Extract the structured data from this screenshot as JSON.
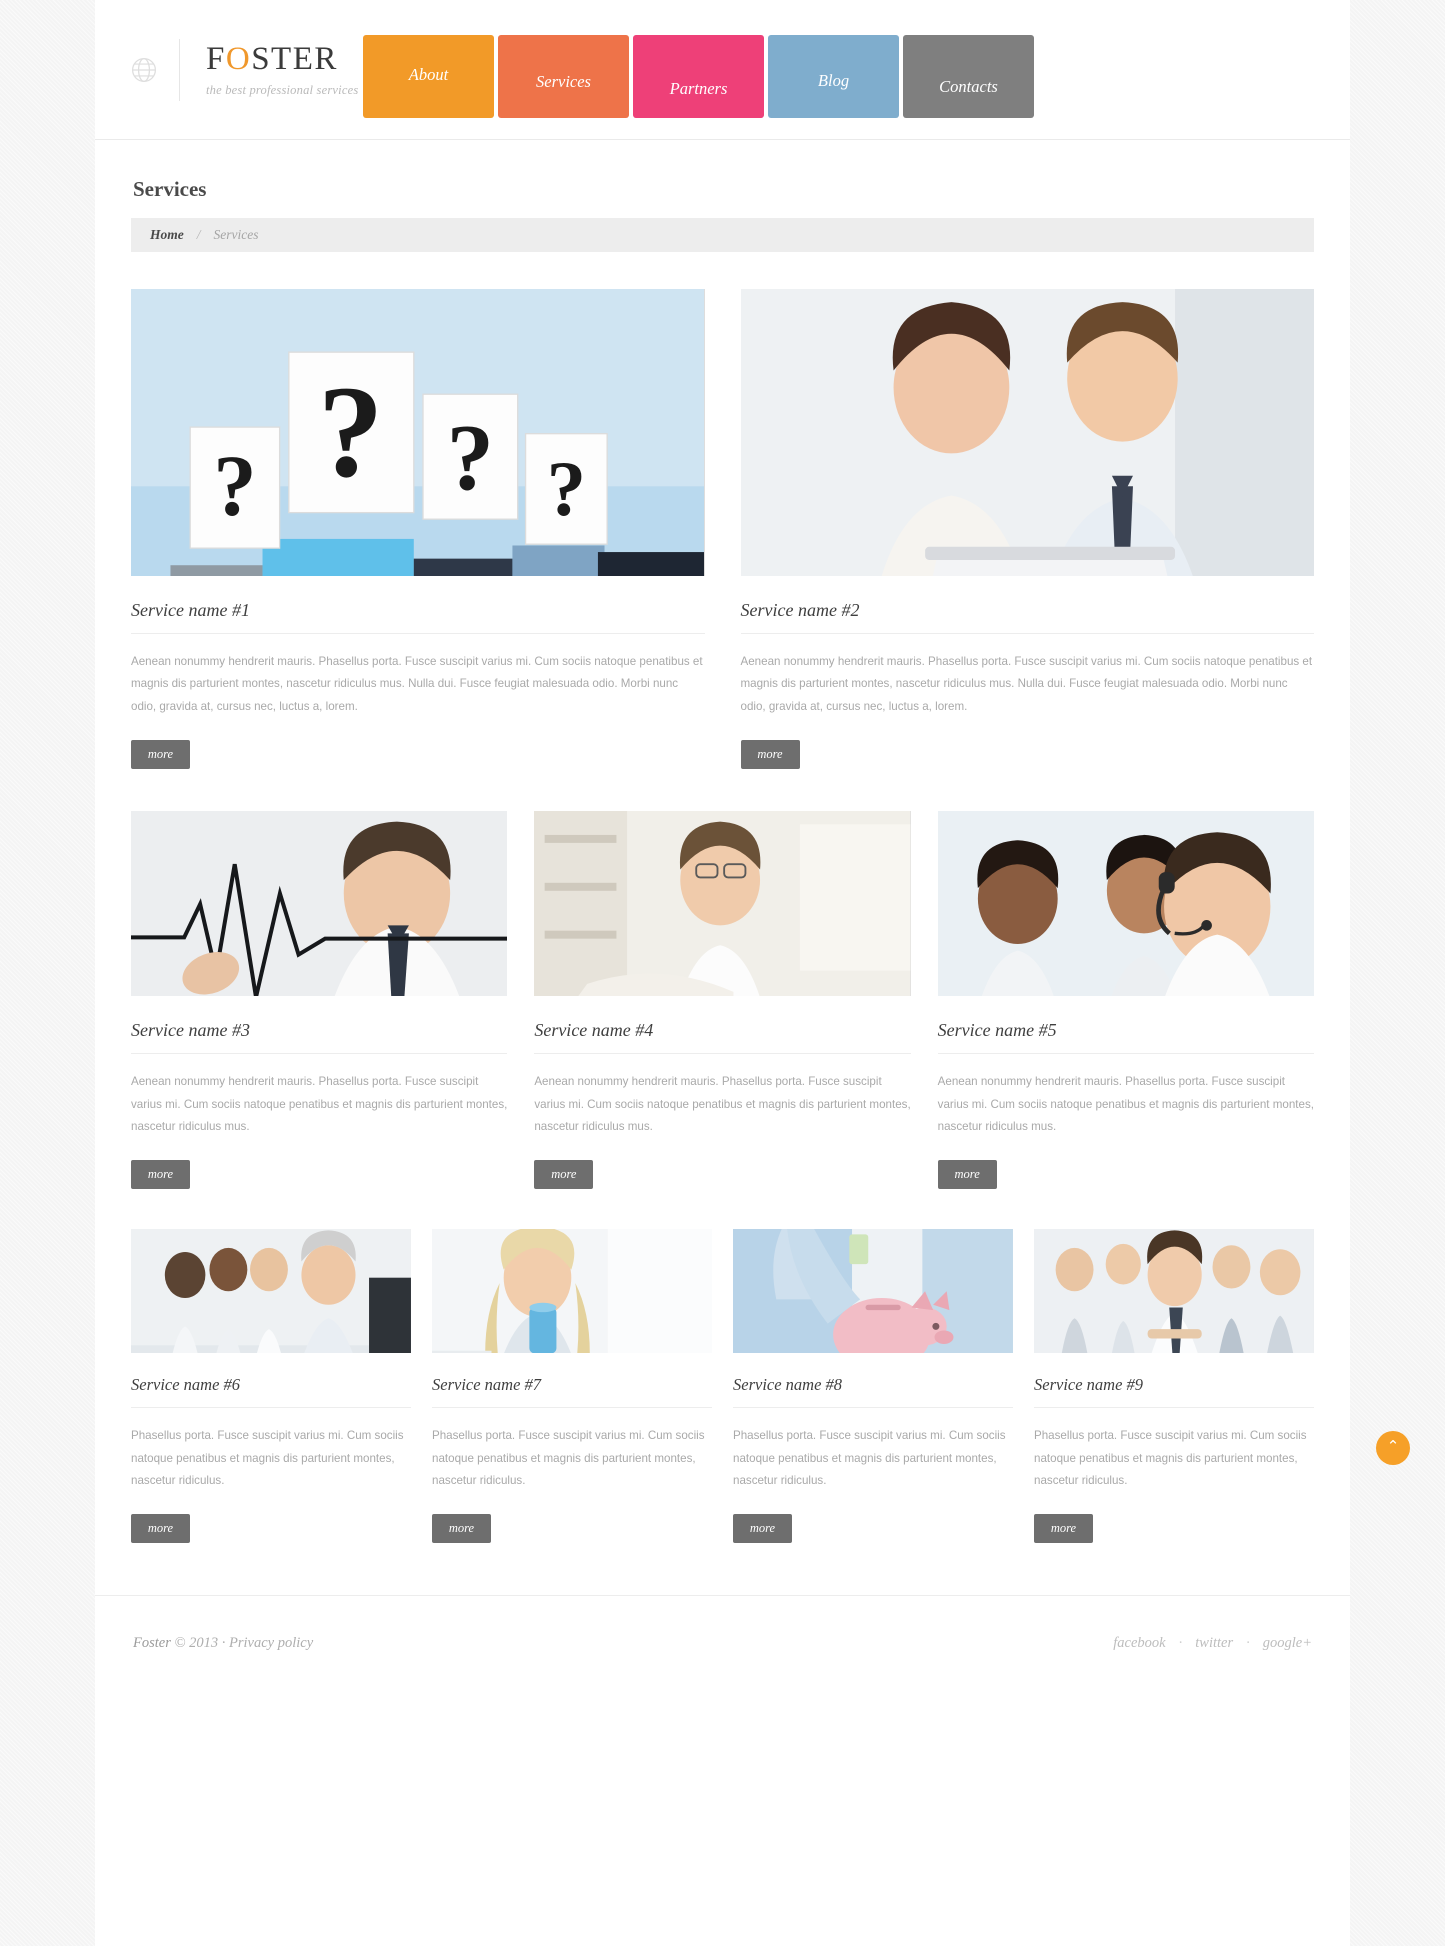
{
  "header": {
    "logo": {
      "part1": "F",
      "accent": "O",
      "part2": "STER",
      "full": "FOSTER"
    },
    "tagline": "the best professional services",
    "globe_icon": "globe-icon",
    "nav": [
      {
        "label": "About",
        "color": "#f29a28"
      },
      {
        "label": "Services",
        "color": "#ee7349"
      },
      {
        "label": "Partners",
        "color": "#ee4078"
      },
      {
        "label": "Blog",
        "color": "#7fadcd"
      },
      {
        "label": "Contacts",
        "color": "#7f7f7f"
      }
    ]
  },
  "page": {
    "title": "Services",
    "breadcrumb": {
      "home": "Home",
      "separator": "/",
      "current": "Services"
    }
  },
  "services": {
    "row1": [
      {
        "title": "Service name #1",
        "text": "Aenean nonummy hendrerit mauris. Phasellus porta. Fusce suscipit varius mi. Cum sociis natoque penatibus et magnis dis parturient montes, nascetur ridiculus mus. Nulla dui. Fusce feugiat malesuada odio. Morbi nunc odio, gravida at, cursus nec, luctus a, lorem.",
        "button": "more",
        "image": "people-holding-question-mark-signs"
      },
      {
        "title": "Service name #2",
        "text": "Aenean nonummy hendrerit mauris. Phasellus porta. Fusce suscipit varius mi. Cum sociis natoque penatibus et magnis dis parturient montes, nascetur ridiculus mus. Nulla dui. Fusce feugiat malesuada odio. Morbi nunc odio, gravida at, cursus nec, luctus a, lorem.",
        "button": "more",
        "image": "couple-looking-at-laptop"
      }
    ],
    "row2": [
      {
        "title": "Service name #3",
        "text": "Aenean nonummy hendrerit mauris. Phasellus porta. Fusce suscipit varius mi. Cum sociis natoque penatibus et magnis dis parturient montes, nascetur ridiculus mus.",
        "button": "more",
        "image": "man-drawing-heartbeat-line"
      },
      {
        "title": "Service name #4",
        "text": "Aenean nonummy hendrerit mauris. Phasellus porta. Fusce suscipit varius mi. Cum sociis natoque penatibus et magnis dis parturient montes, nascetur ridiculus mus.",
        "button": "more",
        "image": "man-on-sofa-with-laptop"
      },
      {
        "title": "Service name #5",
        "text": "Aenean nonummy hendrerit mauris. Phasellus porta. Fusce suscipit varius mi. Cum sociis natoque penatibus et magnis dis parturient montes, nascetur ridiculus mus.",
        "button": "more",
        "image": "call-center-agents-with-headsets"
      }
    ],
    "row3": [
      {
        "title": "Service name #6",
        "text": "Phasellus porta. Fusce suscipit varius mi. Cum sociis natoque penatibus et magnis dis parturient montes, nascetur ridiculus.",
        "button": "more",
        "image": "team-at-office-desk"
      },
      {
        "title": "Service name #7",
        "text": "Phasellus porta. Fusce suscipit varius mi. Cum sociis natoque penatibus et magnis dis parturient montes, nascetur ridiculus.",
        "button": "more",
        "image": "woman-holding-blue-mug"
      },
      {
        "title": "Service name #8",
        "text": "Phasellus porta. Fusce suscipit varius mi. Cum sociis natoque penatibus et magnis dis parturient montes, nascetur ridiculus.",
        "button": "more",
        "image": "hand-putting-money-in-piggy-bank"
      },
      {
        "title": "Service name #9",
        "text": "Phasellus porta. Fusce suscipit varius mi. Cum sociis natoque penatibus et magnis dis parturient montes, nascetur ridiculus.",
        "button": "more",
        "image": "business-team-group-portrait"
      }
    ]
  },
  "footer": {
    "brand": "Foster",
    "copyright": "© 2013",
    "separator": "·",
    "privacy": "Privacy policy",
    "social": [
      {
        "label": "facebook"
      },
      {
        "label": "twitter"
      },
      {
        "label": "google+"
      }
    ],
    "social_dot": "·",
    "back_to_top": "⌃"
  },
  "colors": {
    "accent": "#f0982c",
    "button": "#6e6e6e",
    "breadcrumb_bg": "#ededed"
  }
}
